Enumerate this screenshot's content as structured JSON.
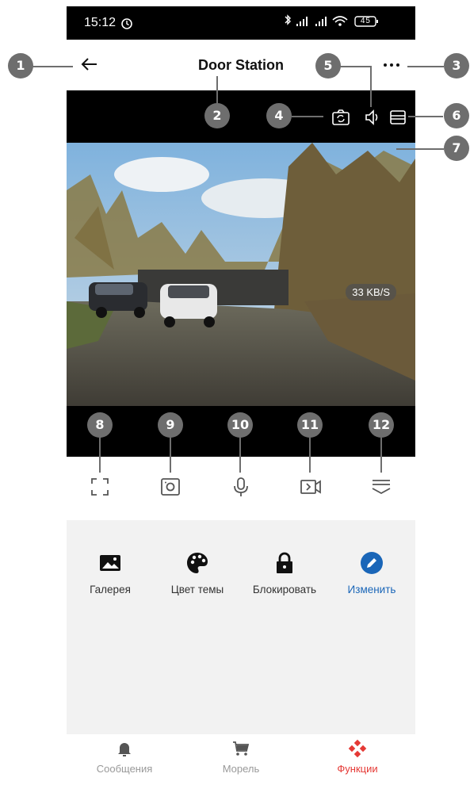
{
  "status_bar": {
    "time": "15:12",
    "battery": "45"
  },
  "app_bar": {
    "title": "Door Station"
  },
  "video": {
    "speed": "33 KB/S"
  },
  "features": [
    {
      "label": "Галерея",
      "icon": "gallery-icon"
    },
    {
      "label": "Цвет темы",
      "icon": "palette-icon"
    },
    {
      "label": "Блокировать",
      "icon": "lock-icon"
    },
    {
      "label": "Изменить",
      "icon": "edit-icon"
    }
  ],
  "bottom_nav": [
    {
      "label": "Сообщения",
      "icon": "bell-icon"
    },
    {
      "label": "Морель",
      "icon": "cart-icon"
    },
    {
      "label": "Функции",
      "icon": "functions-icon"
    }
  ],
  "callouts": [
    "1",
    "2",
    "3",
    "4",
    "5",
    "6",
    "7",
    "8",
    "9",
    "10",
    "11",
    "12"
  ],
  "colors": {
    "accent_blue": "#1a66b8",
    "active_red": "#e53935",
    "callout_gray": "#6e6e6e"
  }
}
